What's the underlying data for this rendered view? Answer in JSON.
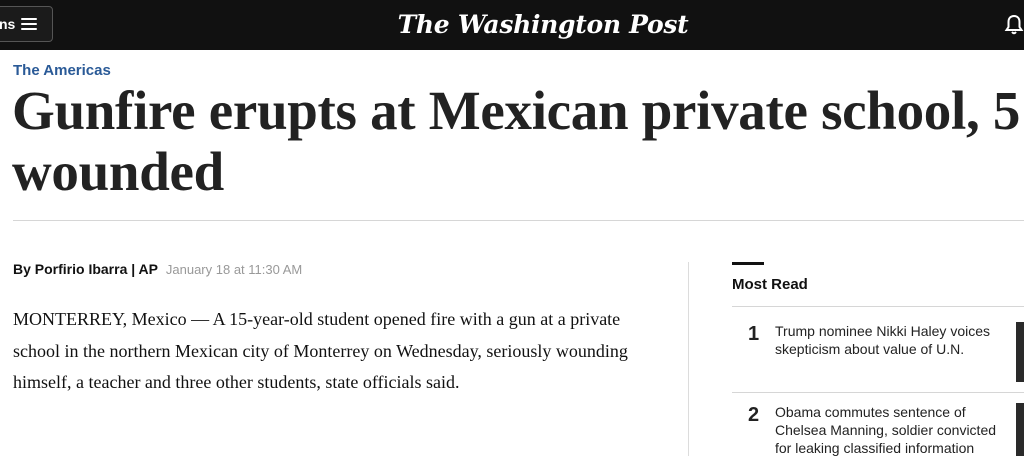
{
  "header": {
    "sections_label": "ns",
    "logo": "The Washington Post",
    "icons": [
      "hamburger-icon",
      "bell-icon"
    ]
  },
  "article": {
    "kicker": "The Americas",
    "headline": "Gunfire erupts at Mexican private school, 5 wounded",
    "author": "By Porfirio Ibarra | AP",
    "timestamp": "January 18 at 11:30 AM",
    "body": "MONTERREY, Mexico — A 15-year-old student opened fire with a gun at a private school in the northern Mexican city of Monterrey on Wednesday, seriously wounding himself, a teacher and three other students, state officials said."
  },
  "most_read": {
    "title": "Most Read",
    "items": [
      {
        "number": "1",
        "text": "Trump nominee Nikki Haley voices skepticism about value of U.N."
      },
      {
        "number": "2",
        "text": "Obama commutes sentence of Chelsea Manning, soldier convicted for leaking classified information"
      }
    ]
  },
  "colors": {
    "header_bg": "#111111",
    "kicker": "#2a5a97",
    "timestamp": "#999999"
  }
}
